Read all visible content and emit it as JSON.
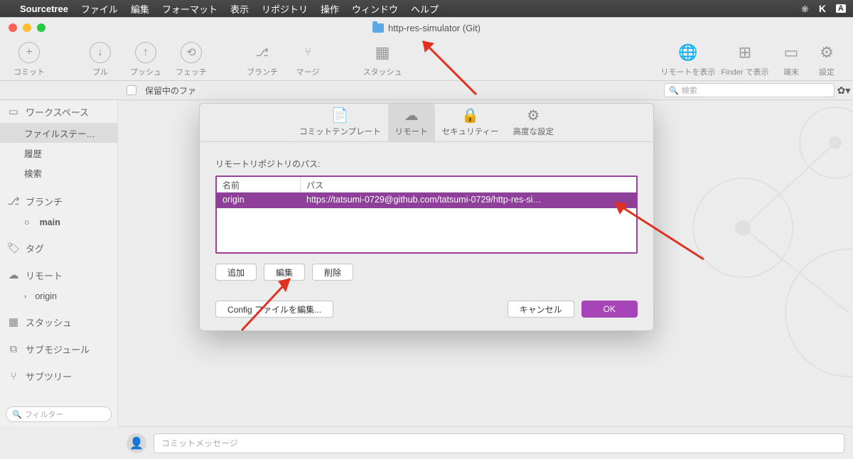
{
  "menubar": {
    "app": "Sourcetree",
    "items": [
      "ファイル",
      "編集",
      "フォーマット",
      "表示",
      "リポジトリ",
      "操作",
      "ウィンドウ",
      "ヘルプ"
    ]
  },
  "window": {
    "title": "http-res-simulator (Git)"
  },
  "toolbar": {
    "commit": "コミット",
    "pull": "プル",
    "push": "プッシュ",
    "fetch": "フェッチ",
    "branch": "ブランチ",
    "merge": "マージ",
    "stash": "スタッシュ",
    "show_remote": "リモートを表示",
    "show_finder": "Finder で表示",
    "terminal": "端末",
    "settings": "設定"
  },
  "headerstrip": {
    "pending": "保留中のファ",
    "search_placeholder": "検索"
  },
  "sidebar": {
    "workspace": "ワークスペース",
    "filestatus": "ファイルステー…",
    "history": "履歴",
    "search": "検索",
    "branches": "ブランチ",
    "branch_main": "main",
    "tags": "タグ",
    "remotes": "リモート",
    "remote_origin": "origin",
    "stashes": "スタッシュ",
    "submodules": "サブモジュール",
    "subtrees": "サブツリー",
    "filter_placeholder": "フィルター"
  },
  "commitbar": {
    "placeholder": "コミットメッセージ"
  },
  "modal": {
    "tabs": {
      "commit_template": "コミットテンプレート",
      "remote": "リモート",
      "security": "セキュリティー",
      "advanced": "高度な設定"
    },
    "section_label": "リモートリポジトリのパス:",
    "th_name": "名前",
    "th_path": "パス",
    "row_name": "origin",
    "row_path": "https://tatsumi-0729@github.com/tatsumi-0729/http-res-si…",
    "btn_add": "追加",
    "btn_edit": "編集",
    "btn_delete": "削除",
    "btn_config": "Config ファイルを編集...",
    "btn_cancel": "キャンセル",
    "btn_ok": "OK"
  }
}
